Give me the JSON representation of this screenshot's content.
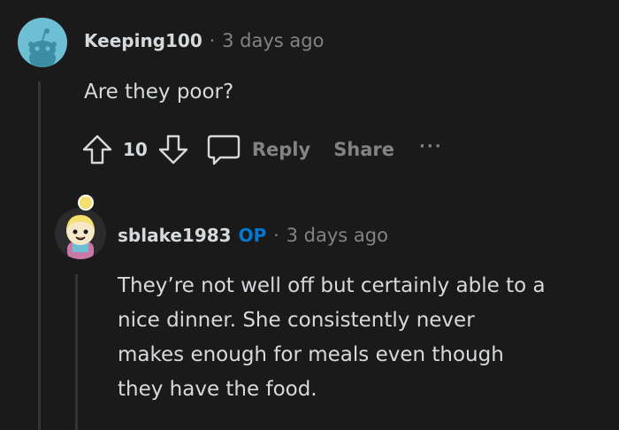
{
  "comment": {
    "username": "Keeping100",
    "separator": "·",
    "time": "3 days ago",
    "text": "Are they poor?",
    "vote_count": "10",
    "reply_label": "Reply",
    "share_label": "Share",
    "more_label": "···"
  },
  "reply": {
    "username": "sblake1983",
    "op_badge": "OP",
    "separator": "·",
    "time": "3 days ago",
    "lines": [
      "They’re not well off but certainly able to a",
      "nice dinner. She consistently never",
      "makes enough for meals even though",
      "they have the food."
    ]
  },
  "colors": {
    "background": "#1a1a1b",
    "text": "#d7dadc",
    "muted": "#818384",
    "op_blue": "#0079d3",
    "avatar_blue": "#6fbfd4"
  }
}
